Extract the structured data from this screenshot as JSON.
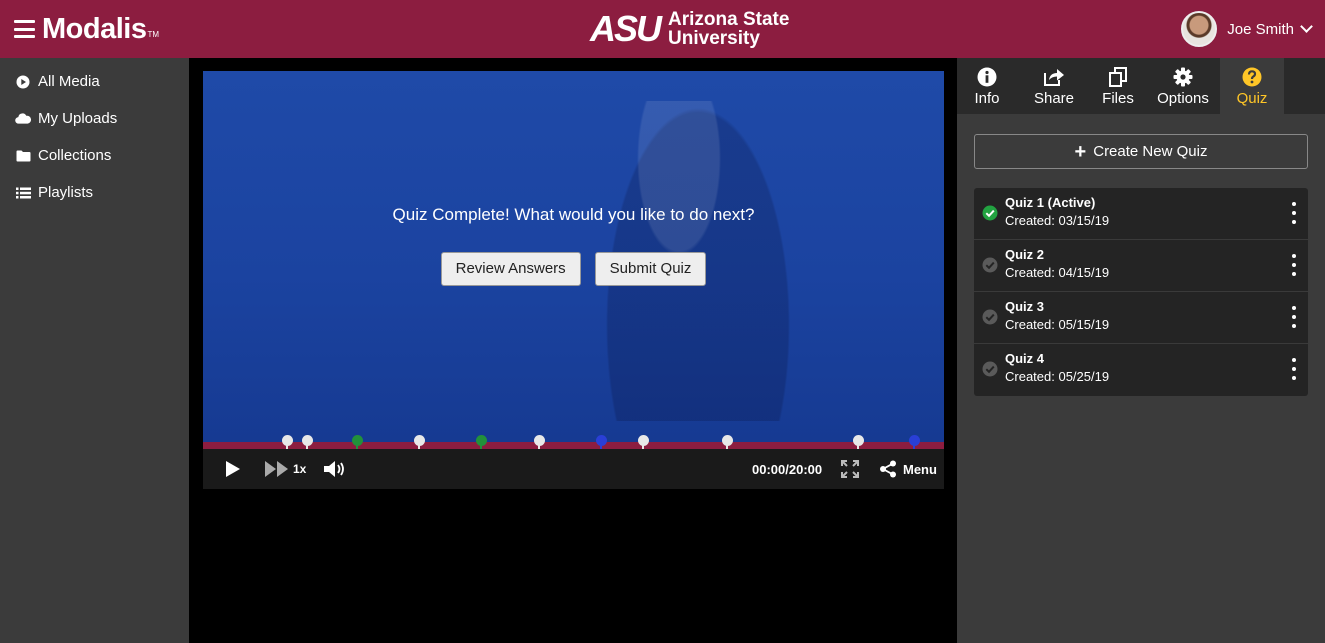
{
  "header": {
    "brand": "Modalis",
    "brand_tm": "TM",
    "university_mark": "ASU",
    "university_line1": "Arizona State",
    "university_line2": "University",
    "user_name": "Joe Smith",
    "bg_color": "#8c1d40"
  },
  "sidebar": {
    "items": [
      {
        "label": "All Media",
        "icon": "play-circle-icon"
      },
      {
        "label": "My Uploads",
        "icon": "cloud-icon"
      },
      {
        "label": "Collections",
        "icon": "folder-icon"
      },
      {
        "label": "Playlists",
        "icon": "list-icon"
      }
    ]
  },
  "player": {
    "overlay_message": "Quiz Complete! What would you like to do next?",
    "review_label": "Review Answers",
    "submit_label": "Submit Quiz",
    "speed": "1x",
    "time": "00:00/20:00",
    "menu_label": "Menu",
    "progress_color": "#8c1d40",
    "markers": [
      {
        "position": 0.113,
        "color": "white"
      },
      {
        "position": 0.14,
        "color": "white"
      },
      {
        "position": 0.208,
        "color": "green"
      },
      {
        "position": 0.292,
        "color": "white"
      },
      {
        "position": 0.375,
        "color": "green"
      },
      {
        "position": 0.454,
        "color": "white"
      },
      {
        "position": 0.537,
        "color": "blue"
      },
      {
        "position": 0.594,
        "color": "white"
      },
      {
        "position": 0.707,
        "color": "white"
      },
      {
        "position": 0.884,
        "color": "white"
      },
      {
        "position": 0.959,
        "color": "blue"
      }
    ]
  },
  "right_panel": {
    "tabs": [
      {
        "label": "Info",
        "icon": "info-icon"
      },
      {
        "label": "Share",
        "icon": "share-icon"
      },
      {
        "label": "Files",
        "icon": "files-icon"
      },
      {
        "label": "Options",
        "icon": "gear-icon"
      },
      {
        "label": "Quiz",
        "icon": "question-icon",
        "active": true
      }
    ],
    "active_color": "#ffc627",
    "create_label": "Create New Quiz",
    "quizzes": [
      {
        "title": "Quiz 1 (Active)",
        "created": "Created: 03/15/19",
        "active": true
      },
      {
        "title": "Quiz 2",
        "created": "Created: 04/15/19",
        "active": false
      },
      {
        "title": "Quiz 3",
        "created": "Created: 05/15/19",
        "active": false
      },
      {
        "title": "Quiz 4",
        "created": "Created: 05/25/19",
        "active": false
      }
    ]
  }
}
